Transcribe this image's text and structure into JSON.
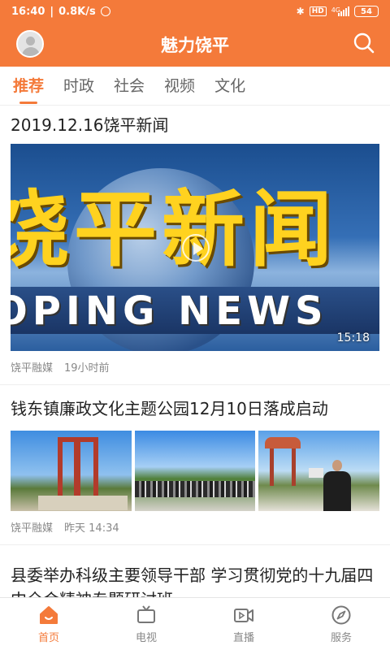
{
  "status_bar": {
    "time": "16:40",
    "speed": "0.8K/s",
    "network": "4G",
    "battery": "54"
  },
  "header": {
    "title": "魅力饶平"
  },
  "tabs": [
    {
      "label": "推荐",
      "active": true
    },
    {
      "label": "时政",
      "active": false
    },
    {
      "label": "社会",
      "active": false
    },
    {
      "label": "视频",
      "active": false
    },
    {
      "label": "文化",
      "active": false
    }
  ],
  "feed": [
    {
      "title": "2019.12.16饶平新闻",
      "video_banner": "饶平新闻",
      "video_banner_en": "OPING NEWS",
      "duration": "15:18",
      "source": "饶平融媒",
      "time": "19小时前"
    },
    {
      "title": "钱东镇廉政文化主题公园12月10日落成启动",
      "source": "饶平融媒",
      "time": "昨天 14:34"
    },
    {
      "title": "县委举办科级主要领导干部 学习贯彻党的十九届四中全会精神专题研讨班"
    }
  ],
  "bottom_nav": [
    {
      "label": "首页",
      "icon": "home-icon",
      "active": true
    },
    {
      "label": "电视",
      "icon": "tv-icon",
      "active": false
    },
    {
      "label": "直播",
      "icon": "live-icon",
      "active": false
    },
    {
      "label": "服务",
      "icon": "compass-icon",
      "active": false
    }
  ],
  "colors": {
    "accent": "#f47a3a"
  }
}
